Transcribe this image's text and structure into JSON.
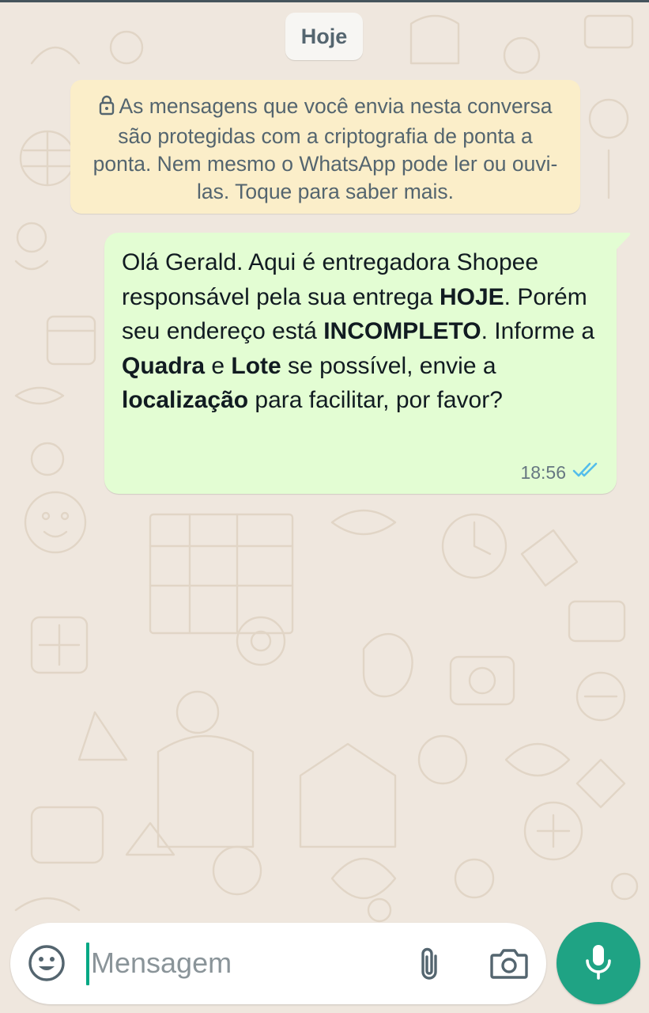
{
  "date_chip": "Hoje",
  "encryption_notice": "As mensagens que você envia nesta conversa são protegidas com a criptografia de ponta a ponta. Nem mesmo o WhatsApp pode ler ou ouvi-las. Toque para saber mais.",
  "message": {
    "p1": "Olá Gerald. Aqui é entregadora Shopee responsável pela sua entrega ",
    "b1": "HOJE",
    "p2": ". Porém seu endereço está ",
    "b2": "INCOMPLETO",
    "p3": ". Informe a ",
    "b3": "Quadra",
    "p4": " e ",
    "b4": "Lote",
    "p5": " se possível, envie a ",
    "b5": "localização",
    "p6": " para facilitar, por favor?",
    "time": "18:56",
    "status": "read"
  },
  "input": {
    "placeholder": "Mensagem"
  },
  "icons": {
    "lock": "lock-icon",
    "read_ticks": "double-check-icon",
    "emoji": "emoji-icon",
    "attach": "paperclip-icon",
    "camera": "camera-icon",
    "mic": "microphone-icon"
  },
  "colors": {
    "wallpaper": "#efe7de",
    "outgoing_bubble": "#e3fdd3",
    "notice_bg": "#fbeec9",
    "accent": "#1fa384",
    "read_tick": "#53bdeb"
  }
}
